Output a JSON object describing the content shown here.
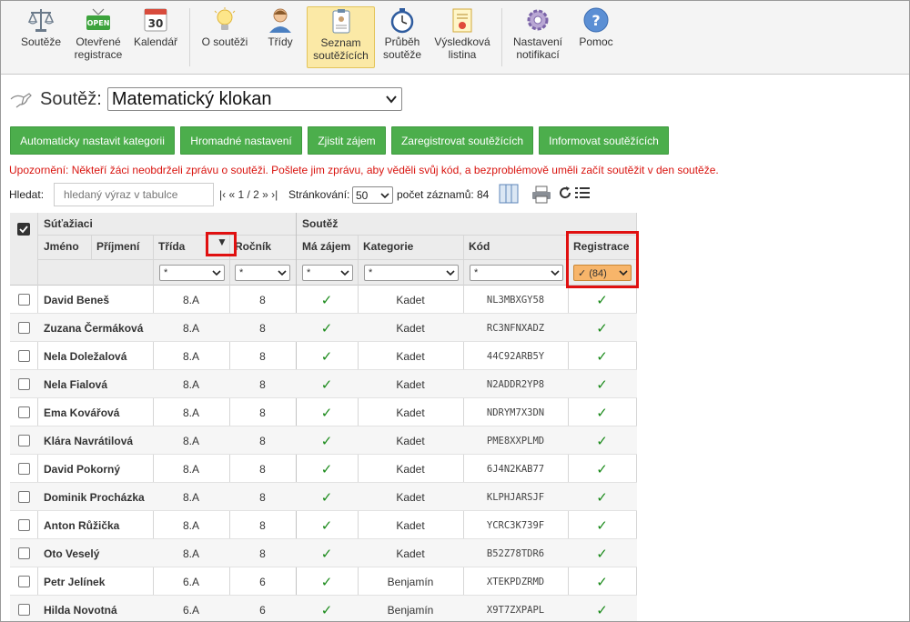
{
  "toolbar": {
    "items": [
      {
        "id": "soutez",
        "label1": "Soutěže",
        "label2": "",
        "icon": "scales-icon"
      },
      {
        "id": "otevrene",
        "label1": "Otevřené",
        "label2": "registrace",
        "icon": "open-sign-icon",
        "badge": "OPEN"
      },
      {
        "id": "kalendar",
        "label1": "Kalendář",
        "label2": "",
        "icon": "calendar-icon",
        "badge": "30"
      },
      {
        "id": "osoutezi",
        "label1": "O soutěži",
        "label2": "",
        "icon": "lightbulb-icon"
      },
      {
        "id": "tridy",
        "label1": "Třídy",
        "label2": "",
        "icon": "person-icon"
      },
      {
        "id": "seznam",
        "label1": "Seznam",
        "label2": "soutěžících",
        "icon": "clipboard-eye-icon",
        "active": true
      },
      {
        "id": "prubeh",
        "label1": "Průběh",
        "label2": "soutěže",
        "icon": "stopwatch-icon"
      },
      {
        "id": "vysledkova",
        "label1": "Výsledková",
        "label2": "listina",
        "icon": "certificate-icon"
      },
      {
        "id": "nastaveni",
        "label1": "Nastavení",
        "label2": "notifikací",
        "icon": "gear-icon"
      },
      {
        "id": "pomoc",
        "label1": "Pomoc",
        "label2": "",
        "icon": "help-icon",
        "badge": "?"
      }
    ]
  },
  "header": {
    "label": "Soutěž:",
    "competition": "Matematický klokan"
  },
  "actions": {
    "auto_category": "Automaticky nastavit kategorii",
    "bulk_settings": "Hromadné nastavení",
    "find_interest": "Zjistit zájem",
    "register": "Zaregistrovat soutěžících",
    "inform": "Informovat soutěžících"
  },
  "warning": "Upozornění: Někteří žáci neobdrželi zprávu o soutěži. Pošlete jim zprávu, aby věděli svůj kód, a bezproblémově uměli začít soutěžit v den soutěže.",
  "search": {
    "label": "Hledat:",
    "placeholder": "hledaný výraz v tabulce"
  },
  "pager": {
    "nav": "|‹ « 1 / 2 » ›|",
    "page_size_label": "Stránkování:",
    "page_size": "50",
    "count_label": "počet záznamů:",
    "count": "84"
  },
  "table": {
    "group_students": "Súťažiaci",
    "group_contest": "Soutěž",
    "col_first": "Jméno",
    "col_last": "Příjmení",
    "col_class": "Třída",
    "col_grade": "Ročník",
    "col_interest": "Má zájem",
    "col_category": "Kategorie",
    "col_code": "Kód",
    "col_registration": "Registrace",
    "sort_arrow": "▼",
    "filter_any": "*",
    "filter_registration": "✓ (84)",
    "tick": "✓",
    "rows": [
      {
        "name": "David Beneš",
        "class": "8.A",
        "grade": "8",
        "category": "Kadet",
        "code": "NL3MBXGY58"
      },
      {
        "name": "Zuzana Čermáková",
        "class": "8.A",
        "grade": "8",
        "category": "Kadet",
        "code": "RC3NFNXADZ"
      },
      {
        "name": "Nela Doležalová",
        "class": "8.A",
        "grade": "8",
        "category": "Kadet",
        "code": "44C92ARB5Y"
      },
      {
        "name": "Nela Fialová",
        "class": "8.A",
        "grade": "8",
        "category": "Kadet",
        "code": "N2ADDR2YP8"
      },
      {
        "name": "Ema Kovářová",
        "class": "8.A",
        "grade": "8",
        "category": "Kadet",
        "code": "NDRYM7X3DN"
      },
      {
        "name": "Klára Navrátilová",
        "class": "8.A",
        "grade": "8",
        "category": "Kadet",
        "code": "PME8XXPLMD"
      },
      {
        "name": "David Pokorný",
        "class": "8.A",
        "grade": "8",
        "category": "Kadet",
        "code": "6J4N2KAB77"
      },
      {
        "name": "Dominik Procházka",
        "class": "8.A",
        "grade": "8",
        "category": "Kadet",
        "code": "KLPHJARSJF"
      },
      {
        "name": "Anton Růžička",
        "class": "8.A",
        "grade": "8",
        "category": "Kadet",
        "code": "YCRC3K739F"
      },
      {
        "name": "Oto Veselý",
        "class": "8.A",
        "grade": "8",
        "category": "Kadet",
        "code": "B52Z78TDR6"
      },
      {
        "name": "Petr Jelínek",
        "class": "6.A",
        "grade": "6",
        "category": "Benjamín",
        "code": "XTEKPDZRMD"
      },
      {
        "name": "Hilda Novotná",
        "class": "6.A",
        "grade": "6",
        "category": "Benjamín",
        "code": "X9T7ZXPAPL"
      }
    ]
  }
}
